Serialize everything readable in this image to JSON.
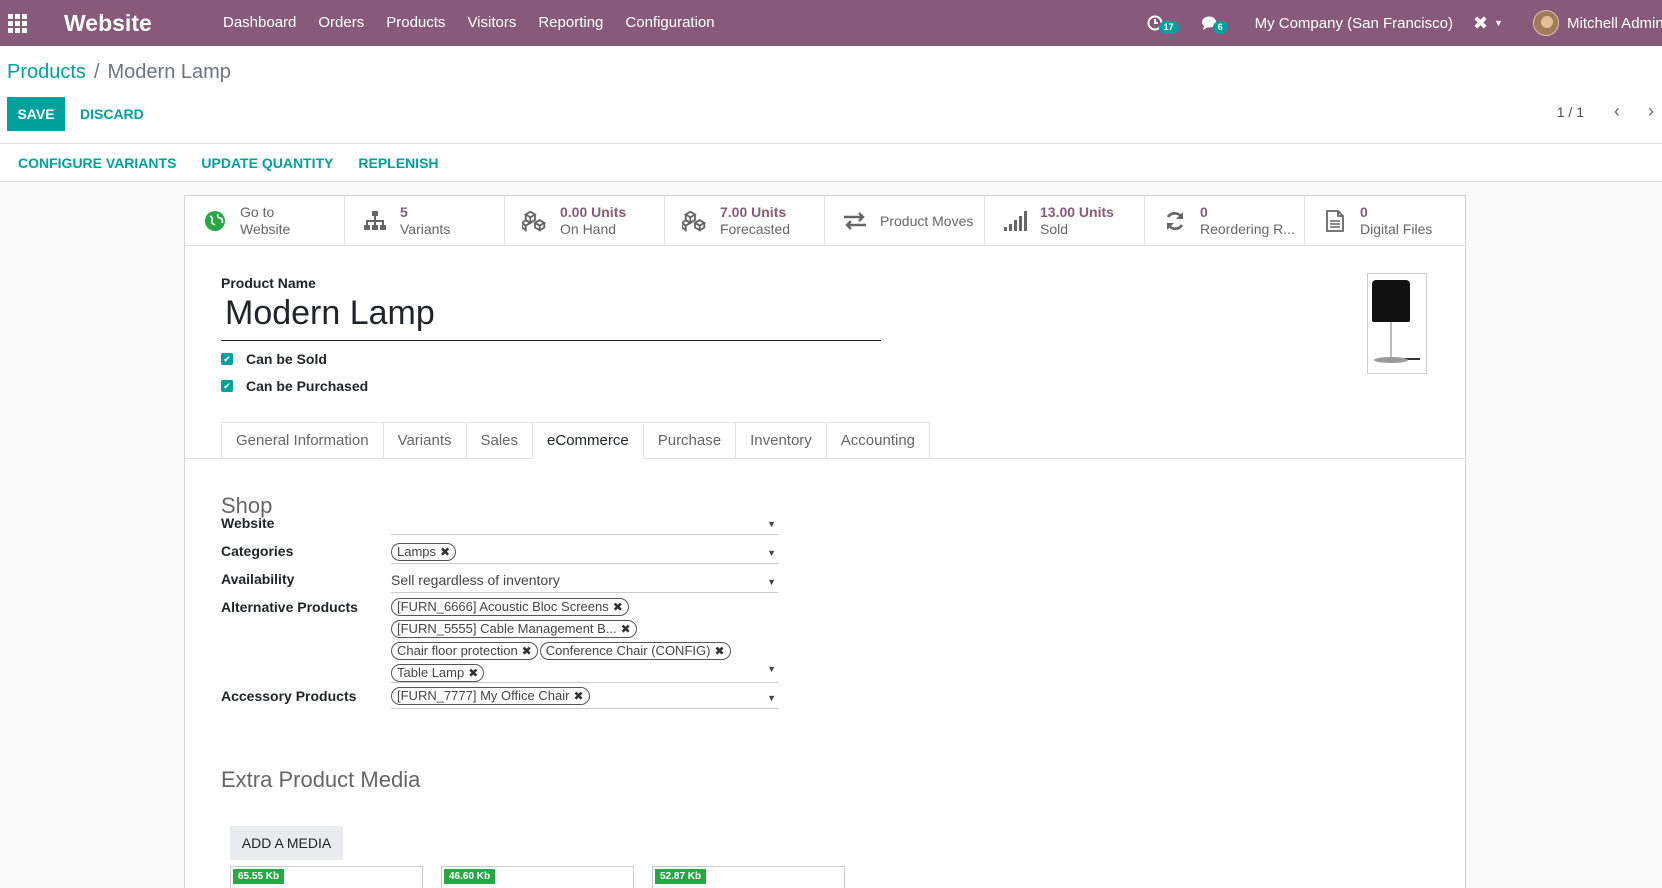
{
  "navbar": {
    "app_name": "Website",
    "menu": [
      "Dashboard",
      "Orders",
      "Products",
      "Visitors",
      "Reporting",
      "Configuration"
    ],
    "activity_count": "17",
    "messages_count": "6",
    "company": "My Company (San Francisco)",
    "user": "Mitchell Admin"
  },
  "breadcrumb": {
    "parent": "Products",
    "separator": "/",
    "current": "Modern Lamp"
  },
  "buttons": {
    "save": "SAVE",
    "discard": "DISCARD"
  },
  "pager": {
    "label": "1 / 1"
  },
  "actions": [
    "CONFIGURE VARIANTS",
    "UPDATE QUANTITY",
    "REPLENISH"
  ],
  "smart_buttons": [
    {
      "value": "Go to",
      "label": "Website",
      "icon": "globe-icon"
    },
    {
      "value": "5",
      "label": "Variants",
      "icon": "sitemap-icon"
    },
    {
      "value": "0.00 Units",
      "label": "On Hand",
      "icon": "cubes-icon"
    },
    {
      "value": "7.00 Units",
      "label": "Forecasted",
      "icon": "cubes-icon"
    },
    {
      "value": "",
      "label": "Product Moves",
      "icon": "exchange-icon"
    },
    {
      "value": "13.00 Units",
      "label": "Sold",
      "icon": "signal-icon"
    },
    {
      "value": "0",
      "label": "Reordering R...",
      "icon": "refresh-icon"
    },
    {
      "value": "0",
      "label": "Digital Files",
      "icon": "file-icon"
    }
  ],
  "form": {
    "product_name_label": "Product Name",
    "product_name": "Modern Lamp",
    "can_be_sold": "Can be Sold",
    "can_be_purchased": "Can be Purchased"
  },
  "tabs": [
    "General Information",
    "Variants",
    "Sales",
    "eCommerce",
    "Purchase",
    "Inventory",
    "Accounting"
  ],
  "active_tab": "eCommerce",
  "shop": {
    "title": "Shop",
    "website_label": "Website",
    "categories_label": "Categories",
    "categories": [
      "Lamps"
    ],
    "availability_label": "Availability",
    "availability_value": "Sell regardless of inventory",
    "alternative_label": "Alternative Products",
    "alternative_products": [
      "[FURN_6666] Acoustic Bloc Screens",
      "[FURN_5555] Cable Management B...",
      "Chair floor protection",
      "Conference Chair (CONFIG)",
      "Table Lamp"
    ],
    "accessory_label": "Accessory Products",
    "accessory_products": [
      "[FURN_7777] My Office Chair"
    ]
  },
  "media": {
    "title": "Extra Product Media",
    "add_button": "ADD A MEDIA",
    "sizes": [
      "65.55 Kb",
      "46.60 Kb",
      "52.87 Kb"
    ]
  },
  "colors": {
    "navbar": "#875a7b",
    "accent": "#00a09d",
    "stat": "#875a7b"
  }
}
